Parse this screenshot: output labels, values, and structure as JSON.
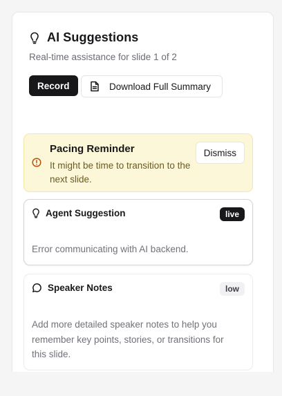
{
  "header": {
    "title": "AI Suggestions",
    "subtitle": "Real-time assistance for slide 1 of 2",
    "icon": "lightbulb-icon"
  },
  "actions": {
    "record_label": "Record",
    "download_label": "Download Full Summary",
    "download_icon": "document-icon"
  },
  "pacing": {
    "title": "Pacing Reminder",
    "message": "It might be time to transition to the next slide.",
    "dismiss_label": "Dismiss",
    "icon": "alert-circle-icon"
  },
  "agent": {
    "title": "Agent Suggestion",
    "badge": "live",
    "message": "Error communicating with AI backend.",
    "icon": "lightbulb-icon"
  },
  "notes": {
    "title": "Speaker Notes",
    "badge": "low",
    "message": "Add more detailed speaker notes to help you remember key points, stories, or transitions for this slide.",
    "icon": "chat-bubble-icon"
  },
  "colors": {
    "primary": "#18181b",
    "warning_bg": "#fdf7d9",
    "warning_icon": "#b45309",
    "muted_text": "#71717a"
  }
}
